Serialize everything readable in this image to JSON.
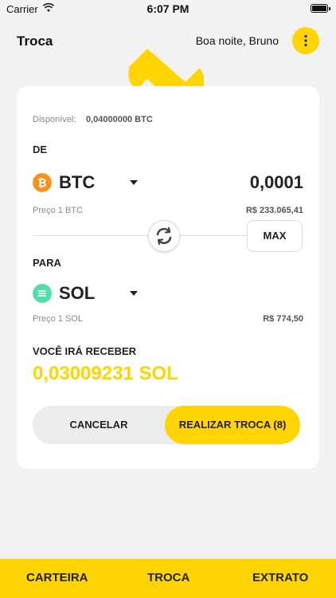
{
  "status_bar": {
    "carrier": "Carrier",
    "time": "6:07 PM"
  },
  "header": {
    "title": "Troca",
    "greeting": "Boa noite, Bruno"
  },
  "card": {
    "available_label": "Disponível:",
    "available_value": "0,04000000 BTC",
    "from_label": "DE",
    "from_coin": "BTC",
    "from_amount": "0,0001",
    "from_price_label": "Preço 1 BTC",
    "from_price_value": "R$ 233.065,41",
    "max_label": "MAX",
    "to_label": "PARA",
    "to_coin": "SOL",
    "to_price_label": "Preço 1 SOL",
    "to_price_value": "R$ 774,50",
    "receive_label": "VOCÊ IRÁ RECEBER",
    "receive_amount": "0,03009231 SOL",
    "cancel_label": "CANCELAR",
    "confirm_label": "REALIZAR TROCA (8)"
  },
  "bottom_nav": {
    "items": [
      "CARTEIRA",
      "TROCA",
      "EXTRATO"
    ]
  },
  "colors": {
    "accent": "#ffd400",
    "btc": "#f7931a",
    "sol": "#4fe0a6"
  },
  "icons": {
    "btc": "bitcoin-icon",
    "sol": "solana-icon",
    "swap": "swap-icon",
    "menu": "more-vertical-icon"
  }
}
